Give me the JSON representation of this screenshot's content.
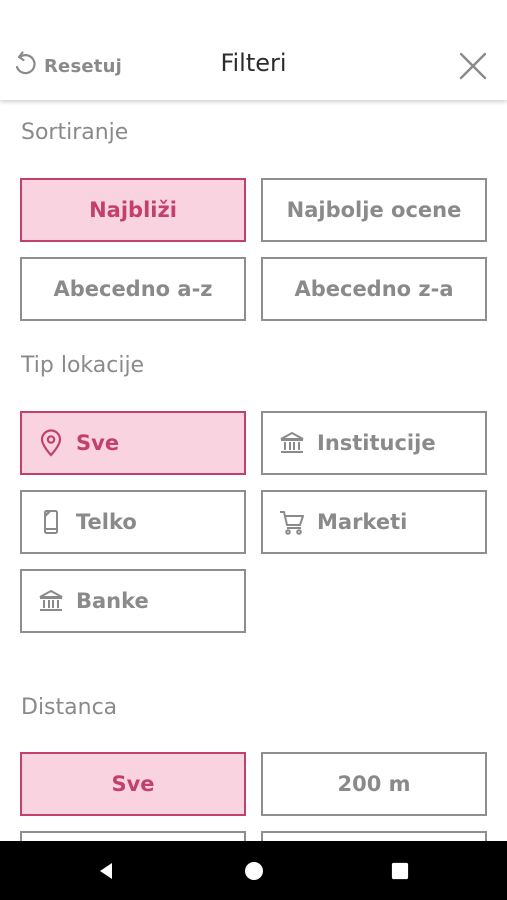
{
  "header": {
    "reset_label": "Resetuj",
    "title": "Filteri"
  },
  "sorting": {
    "title": "Sortiranje",
    "options": [
      {
        "label": "Najbliži",
        "active": true
      },
      {
        "label": "Najbolje ocene",
        "active": false
      },
      {
        "label": "Abecedno a-z",
        "active": false
      },
      {
        "label": "Abecedno z-a",
        "active": false
      }
    ]
  },
  "location_type": {
    "title": "Tip lokacije",
    "options": [
      {
        "label": "Sve",
        "icon": "location-pin-icon",
        "active": true
      },
      {
        "label": "Institucije",
        "icon": "institution-icon",
        "active": false
      },
      {
        "label": "Telko",
        "icon": "phone-icon",
        "active": false
      },
      {
        "label": "Marketi",
        "icon": "cart-icon",
        "active": false
      },
      {
        "label": "Banke",
        "icon": "bank-icon",
        "active": false
      }
    ]
  },
  "distance": {
    "title": "Distanca",
    "options": [
      {
        "label": "Sve",
        "active": true
      },
      {
        "label": "200 m",
        "active": false
      }
    ]
  },
  "colors": {
    "accent": "#c2416c",
    "accent_fill": "#f9d3df",
    "border": "#8e8e8e",
    "text_gray": "#8a8a8a",
    "title_dark": "#2c2c2c"
  },
  "navbar": {
    "back": "back-triangle-icon",
    "home": "home-circle-icon",
    "recents": "recents-square-icon"
  }
}
